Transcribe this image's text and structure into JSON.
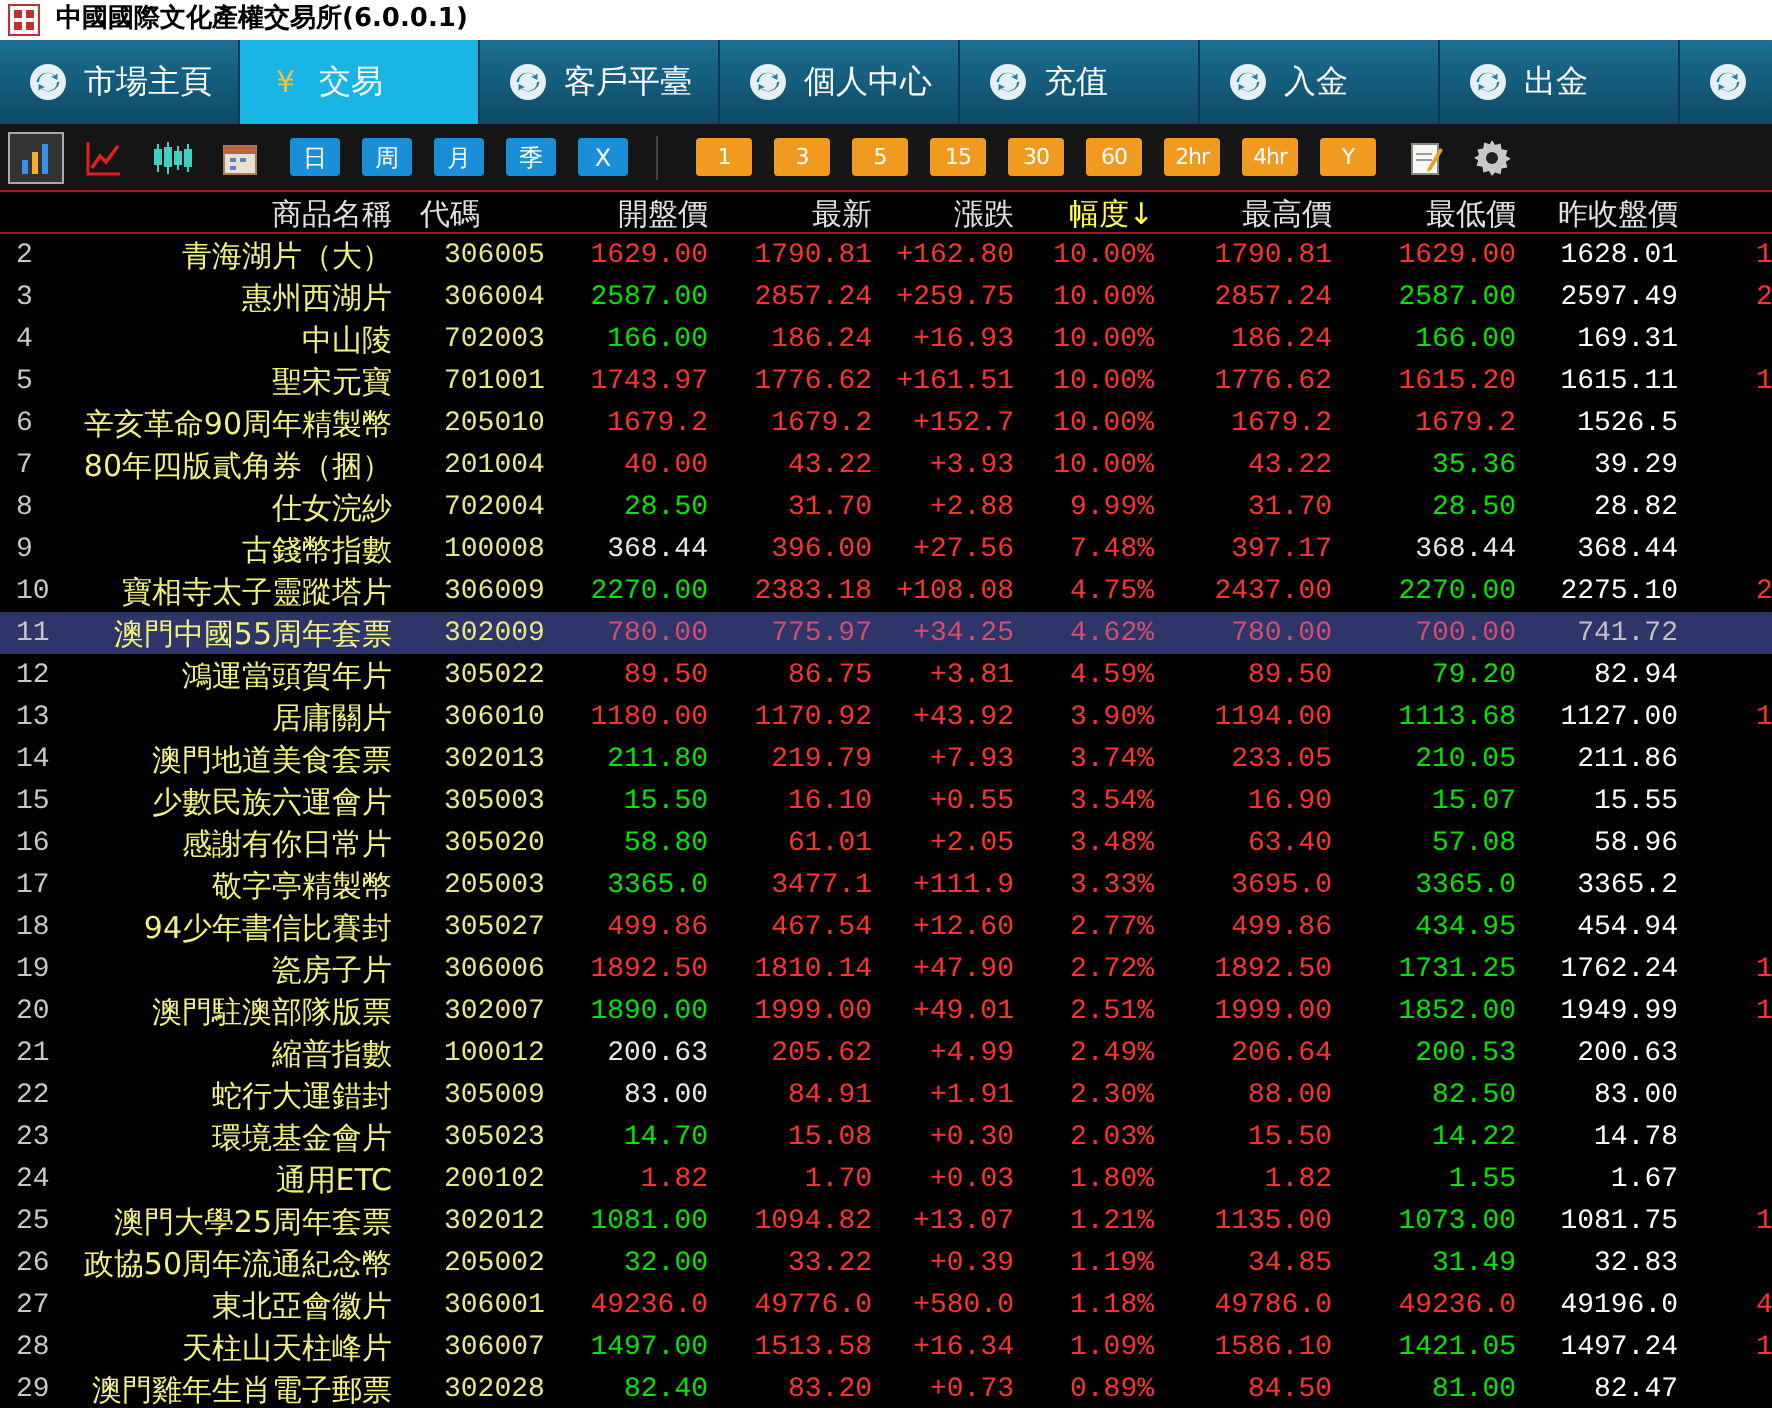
{
  "window": {
    "title": "中國國際文化產權交易所(6.0.0.1)"
  },
  "tabs": [
    {
      "label": "市場主頁",
      "selected": false
    },
    {
      "label": "交易",
      "selected": true,
      "symbol": "¥"
    },
    {
      "label": "客戶平臺",
      "selected": false
    },
    {
      "label": "個人中心",
      "selected": false
    },
    {
      "label": "充值",
      "selected": false
    },
    {
      "label": "入金",
      "selected": false
    },
    {
      "label": "出金",
      "selected": false
    },
    {
      "selected": false
    }
  ],
  "toolbar": {
    "chart_tools": [
      {
        "kind": "bars",
        "selected": true
      },
      {
        "kind": "line",
        "selected": false
      },
      {
        "kind": "candles",
        "selected": false
      },
      {
        "kind": "calendar",
        "selected": false
      }
    ],
    "periods": [
      "日",
      "周",
      "月",
      "季",
      "X"
    ],
    "intervals": [
      "1",
      "3",
      "5",
      "15",
      "30",
      "60",
      "2hr",
      "4hr",
      "Y"
    ],
    "extra_tools": [
      {
        "kind": "note"
      },
      {
        "kind": "settings"
      }
    ]
  },
  "table": {
    "columns": [
      {
        "label": "商品名稱"
      },
      {
        "label": "代碼"
      },
      {
        "label": "開盤價"
      },
      {
        "label": "最新"
      },
      {
        "label": "漲跌"
      },
      {
        "label": "幅度",
        "arrow": "↓"
      },
      {
        "label": "最高價"
      },
      {
        "label": "最低價"
      },
      {
        "label": "昨收盤價"
      }
    ],
    "rows": [
      {
        "no": "2",
        "name": "青海湖片（大）",
        "code": "306005",
        "open": "1629.00",
        "latest": "1790.81",
        "change": "+162.80",
        "pct": "10.00%",
        "high": "1790.81",
        "low": "1629.00",
        "prev": "1628.01",
        "column_9": "1",
        "selected": false
      },
      {
        "no": "3",
        "name": "惠州西湖片",
        "code": "306004",
        "open": "2587.00",
        "latest": "2857.24",
        "change": "+259.75",
        "pct": "10.00%",
        "high": "2857.24",
        "low": "2587.00",
        "prev": "2597.49",
        "column_9": "2",
        "selected": false
      },
      {
        "no": "4",
        "name": "中山陵",
        "code": "702003",
        "open": "166.00",
        "latest": "186.24",
        "change": "+16.93",
        "pct": "10.00%",
        "high": "186.24",
        "low": "166.00",
        "prev": "169.31",
        "selected": false
      },
      {
        "no": "5",
        "name": "聖宋元寶",
        "code": "701001",
        "open": "1743.97",
        "latest": "1776.62",
        "change": "+161.51",
        "pct": "10.00%",
        "high": "1776.62",
        "low": "1615.20",
        "prev": "1615.11",
        "column_9": "1",
        "selected": false
      },
      {
        "no": "6",
        "name": "辛亥革命90周年精製幣",
        "code": "205010",
        "open": "1679.2",
        "latest": "1679.2",
        "change": "+152.7",
        "pct": "10.00%",
        "high": "1679.2",
        "low": "1679.2",
        "prev": "1526.5",
        "selected": false
      },
      {
        "no": "7",
        "name": "80年四版貳角券（捆）",
        "code": "201004",
        "open": "40.00",
        "latest": "43.22",
        "change": "+3.93",
        "pct": "10.00%",
        "high": "43.22",
        "low": "35.36",
        "prev": "39.29",
        "selected": false
      },
      {
        "no": "8",
        "name": "仕女浣紗",
        "code": "702004",
        "open": "28.50",
        "latest": "31.70",
        "change": "+2.88",
        "pct": "9.99%",
        "high": "31.70",
        "low": "28.50",
        "prev": "28.82",
        "selected": false
      },
      {
        "no": "9",
        "name": "古錢幣指數",
        "code": "100008",
        "open": "368.44",
        "latest": "396.00",
        "change": "+27.56",
        "pct": "7.48%",
        "high": "397.17",
        "low": "368.44",
        "prev": "368.44",
        "selected": false
      },
      {
        "no": "10",
        "name": "寶相寺太子靈蹤塔片",
        "code": "306009",
        "open": "2270.00",
        "latest": "2383.18",
        "change": "+108.08",
        "pct": "4.75%",
        "high": "2437.00",
        "low": "2270.00",
        "prev": "2275.10",
        "column_9": "2",
        "selected": false
      },
      {
        "no": "11",
        "name": "澳門中國55周年套票",
        "code": "302009",
        "open": "780.00",
        "latest": "775.97",
        "change": "+34.25",
        "pct": "4.62%",
        "high": "780.00",
        "low": "700.00",
        "prev": "741.72",
        "selected": true
      },
      {
        "no": "12",
        "name": "鴻運當頭賀年片",
        "code": "305022",
        "open": "89.50",
        "latest": "86.75",
        "change": "+3.81",
        "pct": "4.59%",
        "high": "89.50",
        "low": "79.20",
        "prev": "82.94",
        "selected": false
      },
      {
        "no": "13",
        "name": "居庸關片",
        "code": "306010",
        "open": "1180.00",
        "latest": "1170.92",
        "change": "+43.92",
        "pct": "3.90%",
        "high": "1194.00",
        "low": "1113.68",
        "prev": "1127.00",
        "column_9": "1",
        "selected": false
      },
      {
        "no": "14",
        "name": "澳門地道美食套票",
        "code": "302013",
        "open": "211.80",
        "latest": "219.79",
        "change": "+7.93",
        "pct": "3.74%",
        "high": "233.05",
        "low": "210.05",
        "prev": "211.86",
        "selected": false
      },
      {
        "no": "15",
        "name": "少數民族六運會片",
        "code": "305003",
        "open": "15.50",
        "latest": "16.10",
        "change": "+0.55",
        "pct": "3.54%",
        "high": "16.90",
        "low": "15.07",
        "prev": "15.55",
        "selected": false
      },
      {
        "no": "16",
        "name": "感謝有你日常片",
        "code": "305020",
        "open": "58.80",
        "latest": "61.01",
        "change": "+2.05",
        "pct": "3.48%",
        "high": "63.40",
        "low": "57.08",
        "prev": "58.96",
        "selected": false
      },
      {
        "no": "17",
        "name": "敬字亭精製幣",
        "code": "205003",
        "open": "3365.0",
        "latest": "3477.1",
        "change": "+111.9",
        "pct": "3.33%",
        "high": "3695.0",
        "low": "3365.0",
        "prev": "3365.2",
        "selected": false
      },
      {
        "no": "18",
        "name": "94少年書信比賽封",
        "code": "305027",
        "open": "499.86",
        "latest": "467.54",
        "change": "+12.60",
        "pct": "2.77%",
        "high": "499.86",
        "low": "434.95",
        "prev": "454.94",
        "selected": false
      },
      {
        "no": "19",
        "name": "瓷房子片",
        "code": "306006",
        "open": "1892.50",
        "latest": "1810.14",
        "change": "+47.90",
        "pct": "2.72%",
        "high": "1892.50",
        "low": "1731.25",
        "prev": "1762.24",
        "column_9": "1",
        "selected": false
      },
      {
        "no": "20",
        "name": "澳門駐澳部隊版票",
        "code": "302007",
        "open": "1890.00",
        "latest": "1999.00",
        "change": "+49.01",
        "pct": "2.51%",
        "high": "1999.00",
        "low": "1852.00",
        "prev": "1949.99",
        "column_9": "1",
        "selected": false
      },
      {
        "no": "21",
        "name": "縮普指數",
        "code": "100012",
        "open": "200.63",
        "latest": "205.62",
        "change": "+4.99",
        "pct": "2.49%",
        "high": "206.64",
        "low": "200.53",
        "prev": "200.63",
        "selected": false
      },
      {
        "no": "22",
        "name": "蛇行大運錯封",
        "code": "305009",
        "open": "83.00",
        "latest": "84.91",
        "change": "+1.91",
        "pct": "2.30%",
        "high": "88.00",
        "low": "82.50",
        "prev": "83.00",
        "selected": false
      },
      {
        "no": "23",
        "name": "環境基金會片",
        "code": "305023",
        "open": "14.70",
        "latest": "15.08",
        "change": "+0.30",
        "pct": "2.03%",
        "high": "15.50",
        "low": "14.22",
        "prev": "14.78",
        "selected": false
      },
      {
        "no": "24",
        "name": "通用ETC",
        "code": "200102",
        "open": "1.82",
        "latest": "1.70",
        "change": "+0.03",
        "pct": "1.80%",
        "high": "1.82",
        "low": "1.55",
        "prev": "1.67",
        "selected": false
      },
      {
        "no": "25",
        "name": "澳門大學25周年套票",
        "code": "302012",
        "open": "1081.00",
        "latest": "1094.82",
        "change": "+13.07",
        "pct": "1.21%",
        "high": "1135.00",
        "low": "1073.00",
        "prev": "1081.75",
        "column_9": "1",
        "selected": false
      },
      {
        "no": "26",
        "name": "政協50周年流通紀念幣",
        "code": "205002",
        "open": "32.00",
        "latest": "33.22",
        "change": "+0.39",
        "pct": "1.19%",
        "high": "34.85",
        "low": "31.49",
        "prev": "32.83",
        "selected": false
      },
      {
        "no": "27",
        "name": "東北亞會徽片",
        "code": "306001",
        "open": "49236.0",
        "latest": "49776.0",
        "change": "+580.0",
        "pct": "1.18%",
        "high": "49786.0",
        "low": "49236.0",
        "prev": "49196.0",
        "column_9": "4",
        "selected": false
      },
      {
        "no": "28",
        "name": "天柱山天柱峰片",
        "code": "306007",
        "open": "1497.00",
        "latest": "1513.58",
        "change": "+16.34",
        "pct": "1.09%",
        "high": "1586.10",
        "low": "1421.05",
        "prev": "1497.24",
        "column_9": "1",
        "selected": false
      },
      {
        "no": "29",
        "name": "澳門雞年生肖電子郵票",
        "code": "302028",
        "open": "82.40",
        "latest": "83.20",
        "change": "+0.73",
        "pct": "0.89%",
        "high": "84.50",
        "low": "81.00",
        "prev": "82.47",
        "selected": false
      }
    ]
  }
}
